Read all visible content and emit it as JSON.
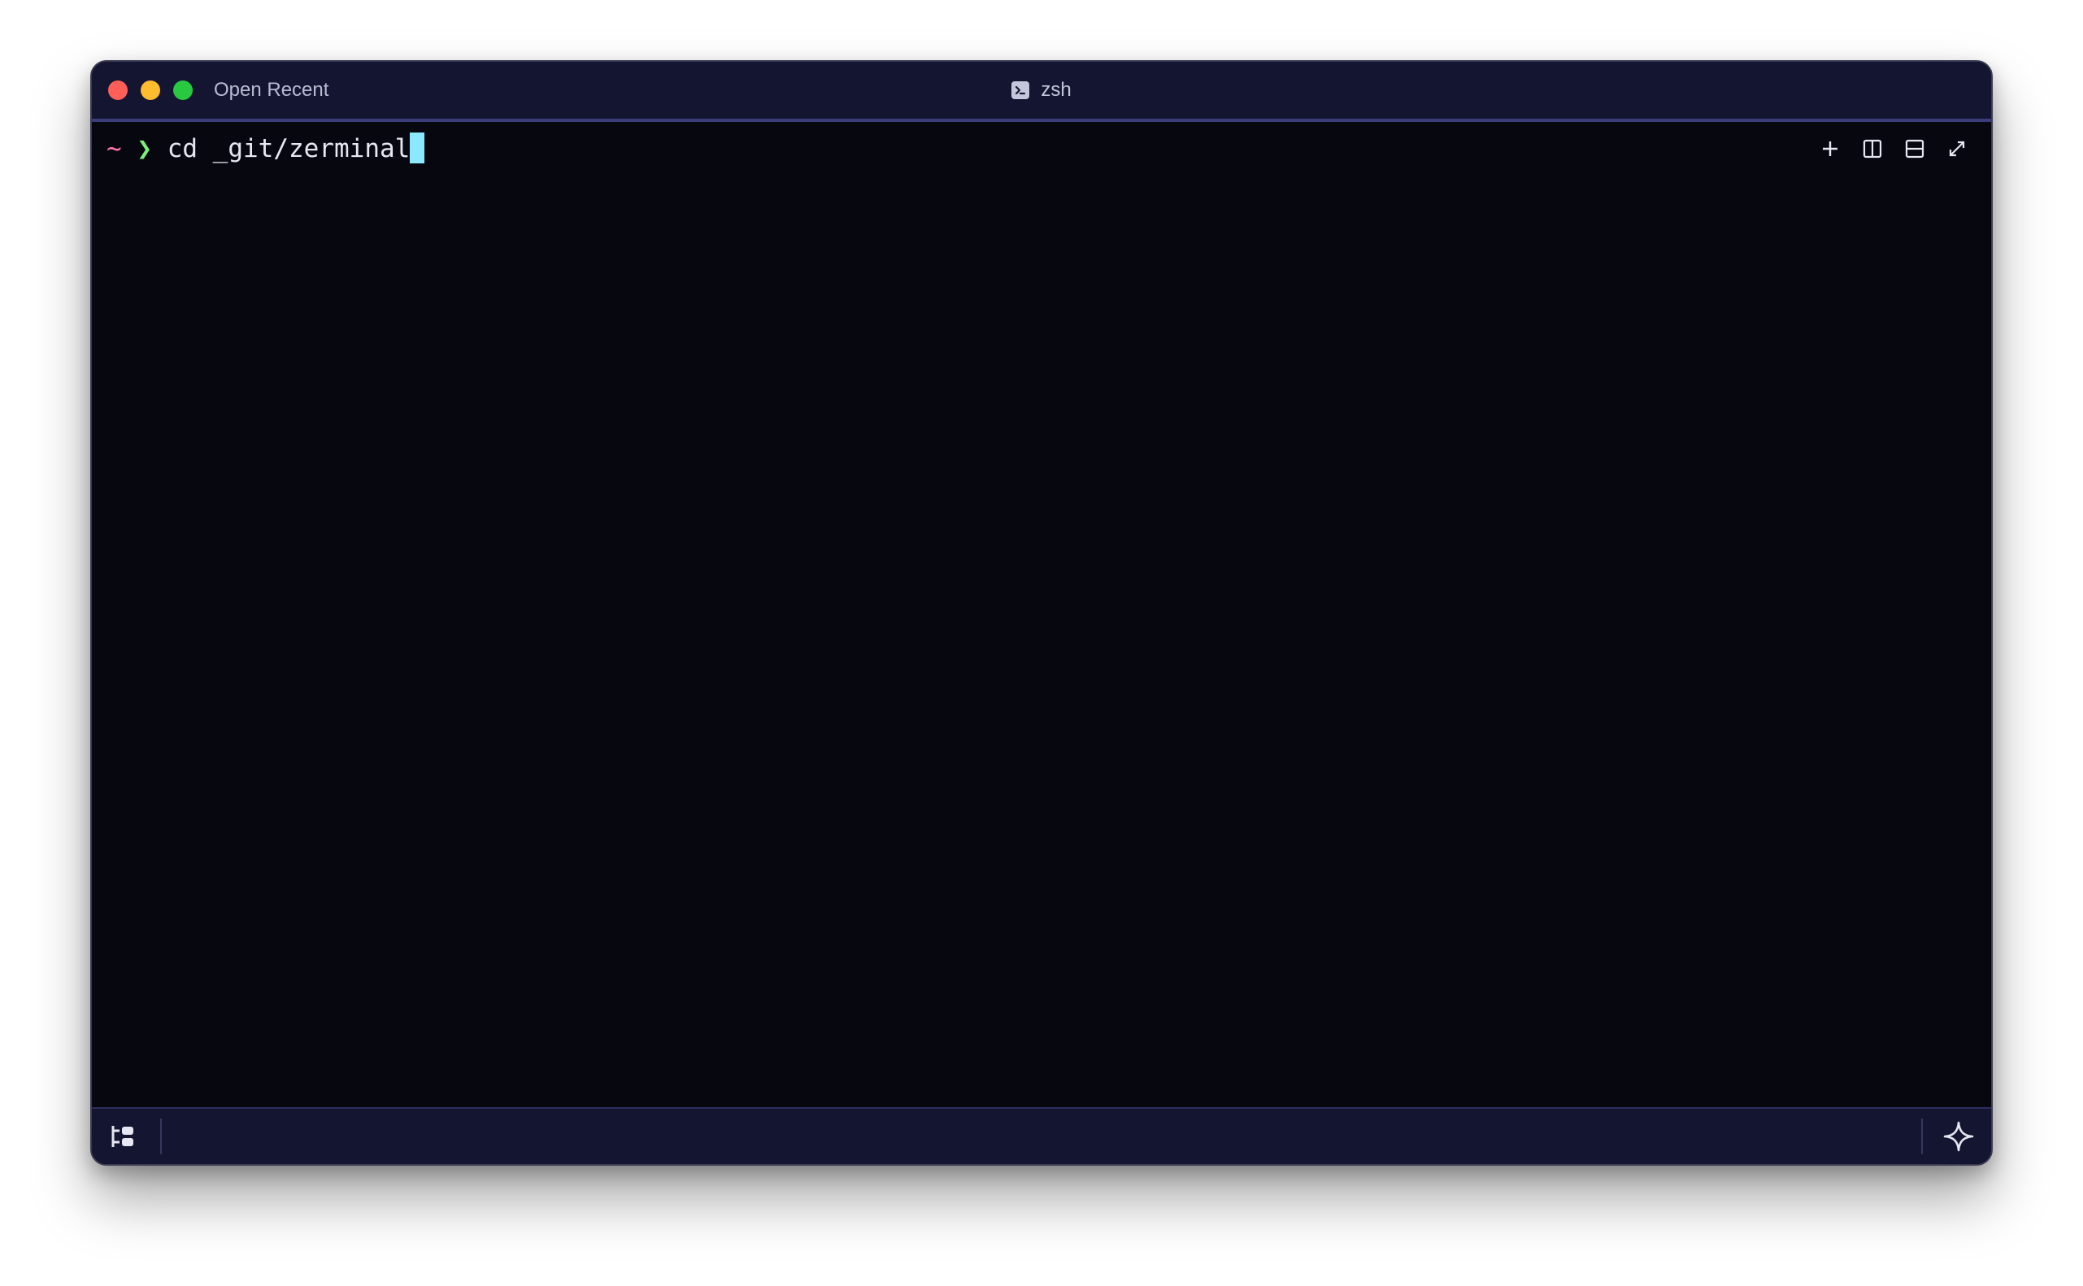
{
  "window": {
    "open_recent_label": "Open Recent",
    "tab_title": "zsh"
  },
  "toolbar": {
    "new_pane_icon": "plus-icon",
    "split_vertical_icon": "split-vertical-icon",
    "split_horizontal_icon": "split-horizontal-icon",
    "fullscreen_icon": "expand-icon"
  },
  "terminal": {
    "prompt_dir": "~",
    "prompt_symbol": "❯",
    "command": "cd _git/zerminal"
  },
  "statusbar": {
    "left_icon": "tree-layout-icon",
    "right_icon": "sparkle-icon"
  },
  "colors": {
    "window_bg": "#07070f",
    "titlebar_bg": "#141530",
    "accent_line": "#3b3d7a",
    "prompt_dir": "#ff79a8",
    "prompt_symbol": "#7ef07a",
    "cursor": "#8be9fd"
  }
}
